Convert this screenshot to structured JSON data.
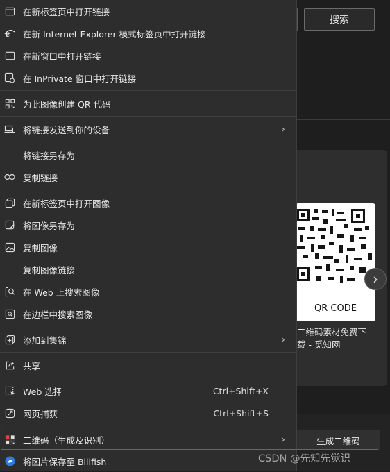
{
  "background": {
    "search_button": "搜索",
    "qr_code_label": "QR CODE",
    "card_caption": [
      "二维码素材免费下",
      "载 - 觅知网"
    ]
  },
  "menu": {
    "items": [
      {
        "label": "在新标签页中打开链接",
        "icon": "new-tab-icon"
      },
      {
        "label": "在新 Internet Explorer 模式标签页中打开链接",
        "icon": "ie-icon"
      },
      {
        "label": "在新窗口中打开链接",
        "icon": "window-icon"
      },
      {
        "label": "在 InPrivate 窗口中打开链接",
        "icon": "inprivate-icon"
      },
      {
        "label": "为此图像创建 QR 代码",
        "icon": "qr-icon"
      },
      {
        "label": "将链接发送到你的设备",
        "icon": "devices-icon"
      },
      {
        "label": "将链接另存为",
        "icon": ""
      },
      {
        "label": "复制链接",
        "icon": "link-icon"
      },
      {
        "label": "在新标签页中打开图像",
        "icon": "image-tab-icon"
      },
      {
        "label": "将图像另存为",
        "icon": "image-save-icon"
      },
      {
        "label": "复制图像",
        "icon": "image-icon"
      },
      {
        "label": "复制图像链接",
        "icon": ""
      },
      {
        "label": "在 Web 上搜索图像",
        "icon": "search-image-icon"
      },
      {
        "label": "在边栏中搜索图像",
        "icon": "sidebar-search-icon"
      },
      {
        "label": "添加到集锦",
        "icon": "collections-icon"
      },
      {
        "label": "共享",
        "icon": "share-icon"
      },
      {
        "label": "Web 选择",
        "icon": "web-select-icon",
        "shortcut": "Ctrl+Shift+X"
      },
      {
        "label": "网页捕获",
        "icon": "capture-icon",
        "shortcut": "Ctrl+Shift+S"
      },
      {
        "label": "二维码（生成及识别）",
        "icon": "qr-extension-icon"
      },
      {
        "label": "将图片保存至 Billfish",
        "icon": "billfish-icon"
      }
    ],
    "submenu_item": "生成二维码"
  },
  "watermark": "CSDN @先知先觉识"
}
